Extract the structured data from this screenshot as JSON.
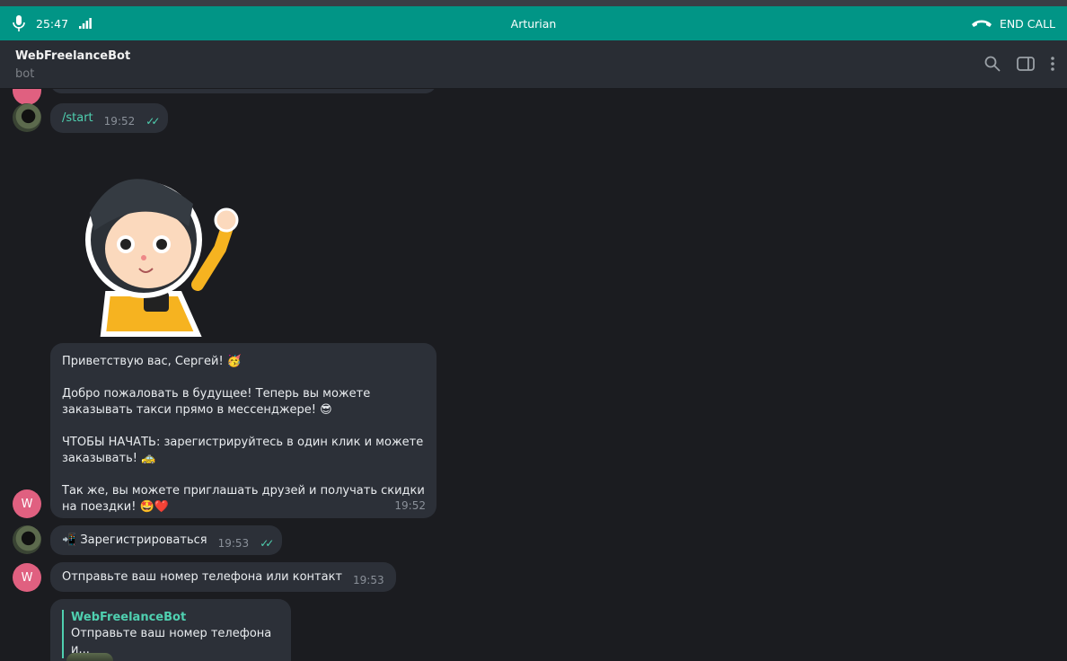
{
  "call": {
    "time": "25:47",
    "name": "Arturian",
    "end_label": "END CALL",
    "color": "#019586"
  },
  "header": {
    "title": "WebFreelanceBot",
    "subtitle": "bot"
  },
  "messages": [
    {
      "from": "user",
      "text": "/start",
      "time": "19:52"
    },
    {
      "from": "bot",
      "lines": [
        "Приветствую вас, Сергей! 🥳",
        "Добро пожаловать в будущее! Теперь вы можете заказывать такси прямо в мессенджере! 😎",
        "ЧТОБЫ НАЧАТЬ: зарегистрируйтесь в один клик и можете заказывать! 🚕",
        "Так же, вы можете приглашать друзей и получать скидки на поездки! 🤩❤️"
      ],
      "time": "19:52"
    },
    {
      "from": "user",
      "text": "📲 Зарегистрироваться",
      "time": "19:53"
    },
    {
      "from": "bot",
      "text": "Отправьте ваш номер телефона или контакт",
      "time": "19:53"
    },
    {
      "from": "user",
      "reply_name": "WebFreelanceBot",
      "reply_text": "Отправьте ваш номер телефона и..."
    }
  ],
  "bot_avatar_letter": "W"
}
